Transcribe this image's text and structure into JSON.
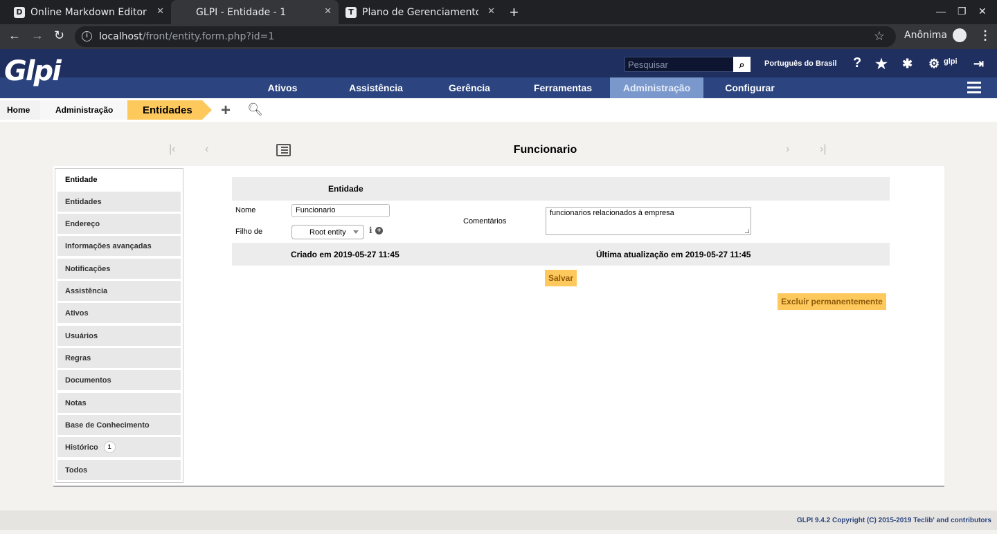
{
  "browser": {
    "tabs": [
      {
        "title": "Online Markdown Editor",
        "favicon": "D"
      },
      {
        "title": "GLPI - Entidade - 1",
        "favicon": ""
      },
      {
        "title": "Plano de Gerenciamento d",
        "favicon": "T"
      }
    ],
    "url_host": "localhost",
    "url_path": "/front/entity.form.php?id=1",
    "profile": "Anônima"
  },
  "header": {
    "logo": "Glpi",
    "search_placeholder": "Pesquisar",
    "language": "Português do Brasil",
    "user": "glpi"
  },
  "menu": {
    "items": [
      "Ativos",
      "Assistência",
      "Gerência",
      "Ferramentas",
      "Administração",
      "Configurar"
    ],
    "active": "Administração"
  },
  "breadcrumb": {
    "home": "Home",
    "section": "Administração",
    "current": "Entidades"
  },
  "page": {
    "title": "Funcionario"
  },
  "sidebar": {
    "items": [
      {
        "label": "Entidade"
      },
      {
        "label": "Entidades"
      },
      {
        "label": "Endereço"
      },
      {
        "label": "Informações avançadas"
      },
      {
        "label": "Notificações"
      },
      {
        "label": "Assistência"
      },
      {
        "label": "Ativos"
      },
      {
        "label": "Usuários"
      },
      {
        "label": "Regras"
      },
      {
        "label": "Documentos"
      },
      {
        "label": "Notas"
      },
      {
        "label": "Base de Conhecimento"
      },
      {
        "label": "Histórico",
        "badge": "1"
      },
      {
        "label": "Todos"
      }
    ]
  },
  "form": {
    "header": "Entidade",
    "name_label": "Nome",
    "name_value": "Funcionario",
    "parent_label": "Filho de",
    "parent_value": "Root entity",
    "comments_label": "Comentários",
    "comments_value": "funcionarios relacionados à empresa",
    "created": "Criado em 2019-05-27 11:45",
    "updated": "Última atualização em 2019-05-27 11:45",
    "save_label": "Salvar",
    "delete_label": "Excluir permanentemente"
  },
  "footer": {
    "text": "GLPI 9.4.2 Copyright (C) 2015-2019 Teclib' and contributors"
  }
}
